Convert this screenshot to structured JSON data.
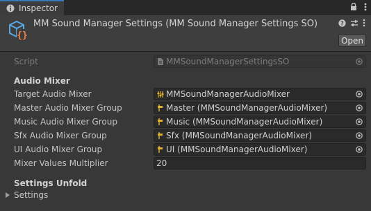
{
  "tab": {
    "label": "Inspector"
  },
  "header": {
    "title": "MM Sound Manager Settings (MM Sound Manager Settings SO)",
    "open_label": "Open"
  },
  "script_row": {
    "label": "Script",
    "value": "MMSoundManagerSettingsSO"
  },
  "audio_mixer": {
    "heading": "Audio Mixer",
    "rows": [
      {
        "label": "Target Audio Mixer",
        "value": "MMSoundManagerAudioMixer",
        "icon": "mixer-icon"
      },
      {
        "label": "Master Audio Mixer Group",
        "value": "Master (MMSoundManagerAudioMixer)",
        "icon": "mixer-group-icon"
      },
      {
        "label": "Music Audio Mixer Group",
        "value": "Music (MMSoundManagerAudioMixer)",
        "icon": "mixer-group-icon"
      },
      {
        "label": "Sfx Audio Mixer Group",
        "value": "Sfx (MMSoundManagerAudioMixer)",
        "icon": "mixer-group-icon"
      },
      {
        "label": "UI Audio Mixer Group",
        "value": "UI (MMSoundManagerAudioMixer)",
        "icon": "mixer-group-icon"
      }
    ],
    "multiplier": {
      "label": "Mixer Values Multiplier",
      "value": "20"
    }
  },
  "settings_unfold": {
    "heading": "Settings Unfold",
    "foldout_label": "Settings"
  }
}
